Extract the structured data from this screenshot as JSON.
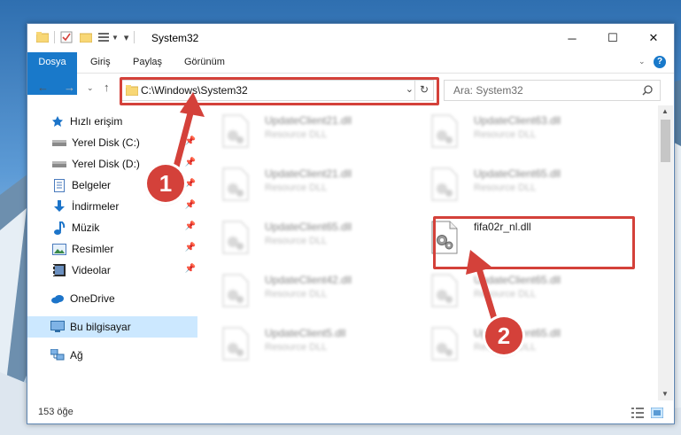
{
  "window": {
    "title": "System32",
    "minimize": "─",
    "maximize": "☐",
    "close": "✕"
  },
  "ribbon": {
    "tabs": [
      "Dosya",
      "Giriş",
      "Paylaş",
      "Görünüm"
    ],
    "help": "?"
  },
  "address": {
    "path": "C:\\Windows\\System32",
    "search_placeholder": "Ara: System32"
  },
  "nav": {
    "items": [
      {
        "label": "Hızlı erişim",
        "icon": "star-icon"
      },
      {
        "label": "Yerel Disk (C:)",
        "icon": "drive-icon",
        "pinned": true
      },
      {
        "label": "Yerel Disk (D:)",
        "icon": "drive-icon",
        "pinned": true
      },
      {
        "label": "Belgeler",
        "icon": "documents-icon",
        "pinned": true
      },
      {
        "label": "İndirmeler",
        "icon": "download-icon",
        "pinned": true
      },
      {
        "label": "Müzik",
        "icon": "music-icon",
        "pinned": true
      },
      {
        "label": "Resimler",
        "icon": "pictures-icon",
        "pinned": true
      },
      {
        "label": "Videolar",
        "icon": "videos-icon",
        "pinned": true
      },
      {
        "label": "OneDrive",
        "icon": "cloud-icon"
      },
      {
        "label": "Bu bilgisayar",
        "icon": "computer-icon",
        "selected": true
      },
      {
        "label": "Ağ",
        "icon": "network-icon"
      }
    ]
  },
  "files": [
    {
      "name": "UpdateClient21.dll",
      "type": "Resource DLL",
      "blurred": true
    },
    {
      "name": "UpdateClient63.dll",
      "type": "Resource DLL",
      "blurred": true
    },
    {
      "name": "UpdateClient21.dll",
      "type": "Resource DLL",
      "blurred": true
    },
    {
      "name": "UpdateClient65.dll",
      "type": "Resource DLL",
      "blurred": true
    },
    {
      "name": "UpdateClient65.dll",
      "type": "Resource DLL",
      "blurred": true
    },
    {
      "name": "fifa02r_nl.dll",
      "type": "",
      "blurred": false
    },
    {
      "name": "UpdateClient42.dll",
      "type": "Resource DLL",
      "blurred": true
    },
    {
      "name": "UpdateClient65.dll",
      "type": "Resource DLL",
      "blurred": true
    },
    {
      "name": "UpdateClient5.dll",
      "type": "Resource DLL",
      "blurred": true
    },
    {
      "name": "UpdateClient65.dll",
      "type": "Resource DLL",
      "blurred": true
    }
  ],
  "status": {
    "count": "153 öğe"
  },
  "callouts": {
    "step1": "1",
    "step2": "2"
  },
  "colors": {
    "accent": "#1979ca",
    "highlight": "#d4413a",
    "selection": "#cce8ff"
  }
}
